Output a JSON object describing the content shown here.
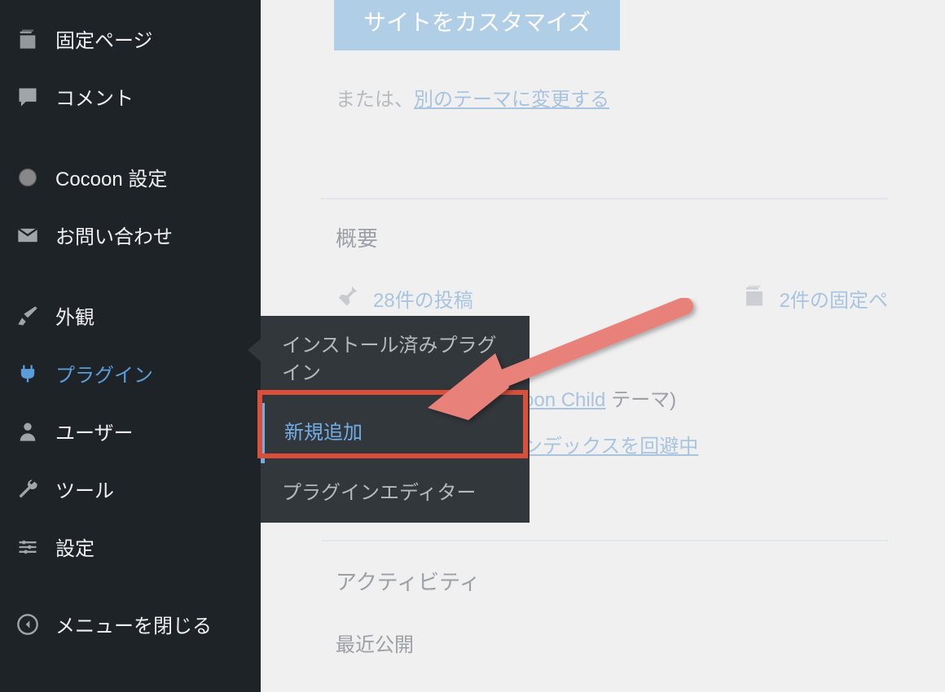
{
  "sidebar": {
    "items": [
      {
        "label": "固定ページ"
      },
      {
        "label": "コメント"
      },
      {
        "label": "Cocoon 設定"
      },
      {
        "label": "お問い合わせ"
      },
      {
        "label": "外観"
      },
      {
        "label": "プラグイン"
      },
      {
        "label": "ユーザー"
      },
      {
        "label": "ツール"
      },
      {
        "label": "設定"
      },
      {
        "label": "メニューを閉じる"
      }
    ]
  },
  "submenu": {
    "items": [
      {
        "label": "インストール済みプラグイン"
      },
      {
        "label": "新規追加"
      },
      {
        "label": "プラグインエディター"
      }
    ]
  },
  "content": {
    "customize_button": "サイトをカスタマイズ",
    "or_prefix": "または、",
    "change_theme_link": "別のテーマに変更する",
    "overview_header": "概要",
    "posts_count": "28件の投稿",
    "pages_count": "2件の固定ペ",
    "theme_name_link": "oon Child",
    "theme_suffix": " テーマ)",
    "index_avoid_link": "ンデックスを回避中",
    "activity_header": "アクティビティ",
    "recent_published": "最近公開"
  }
}
